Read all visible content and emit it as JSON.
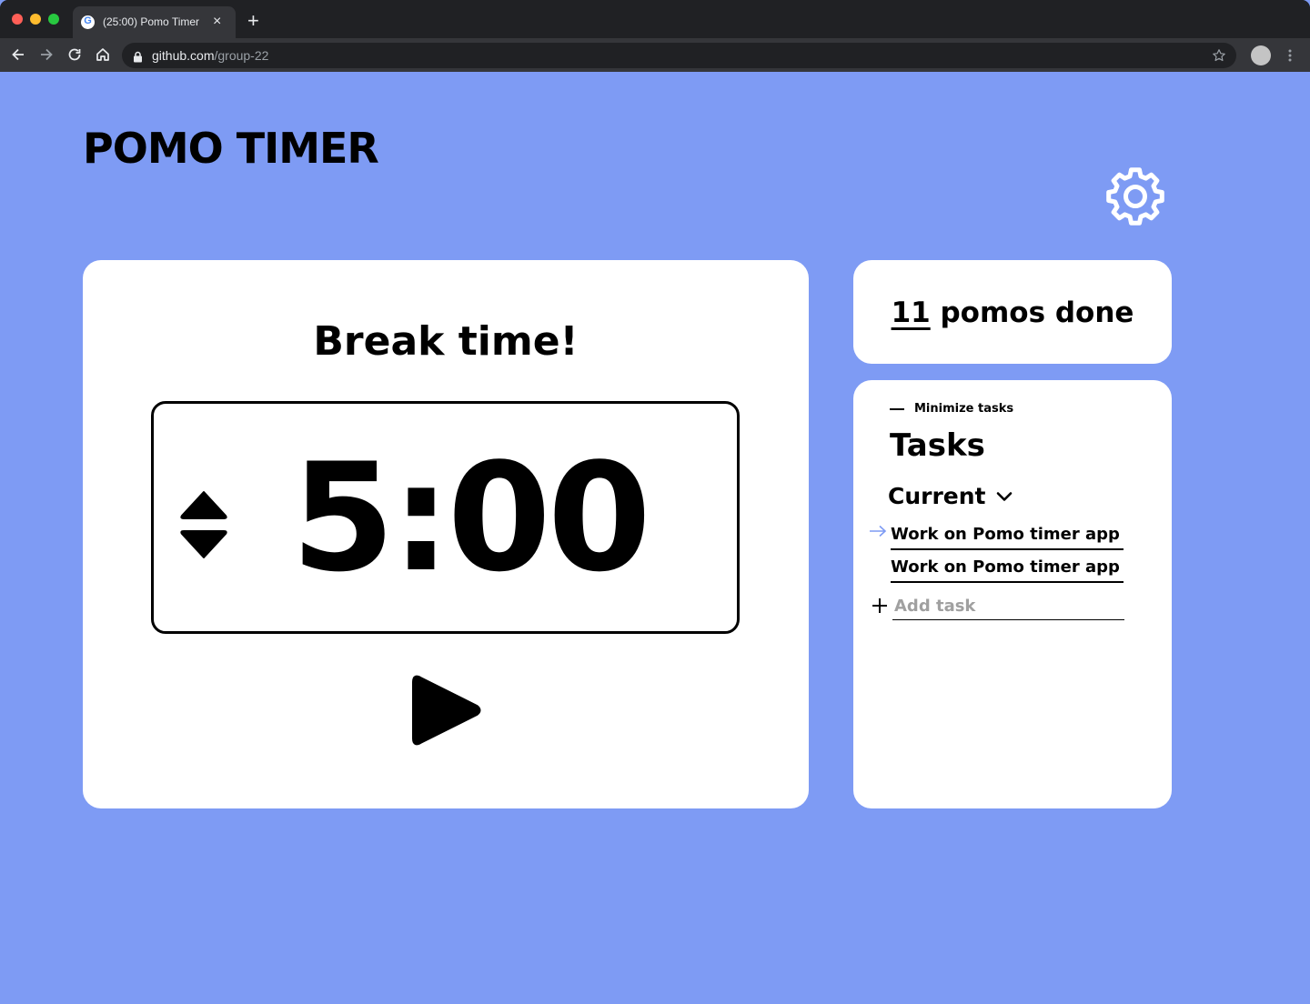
{
  "browser": {
    "tab_title": "(25:00) Pomo Timer",
    "favicon_letter": "G",
    "close_glyph": "×",
    "newtab_glyph": "+",
    "url_host": "github.com",
    "url_path": "/group-22",
    "colors": {
      "frame": "#202124",
      "toolbar": "#35363a",
      "text": "#e8eaed"
    }
  },
  "app": {
    "title": "POMO TIMER",
    "background": "#7e9bf4",
    "settings_icon": "gear-icon"
  },
  "timer": {
    "mode_label": "Break time!",
    "time": "5:00",
    "adjust_icon": "up-down-arrows-icon",
    "play_icon": "play-icon"
  },
  "pomos": {
    "count": "11",
    "label": " pomos done"
  },
  "tasks": {
    "minimize_label": "Minimize tasks",
    "heading": "Tasks",
    "filter_selected": "Current",
    "items": [
      {
        "label": "Work on Pomo timer app",
        "current": true
      },
      {
        "label": "Work on Pomo timer app",
        "current": false
      }
    ],
    "add_placeholder": "Add task",
    "current_marker_color": "#7e9bf4"
  }
}
